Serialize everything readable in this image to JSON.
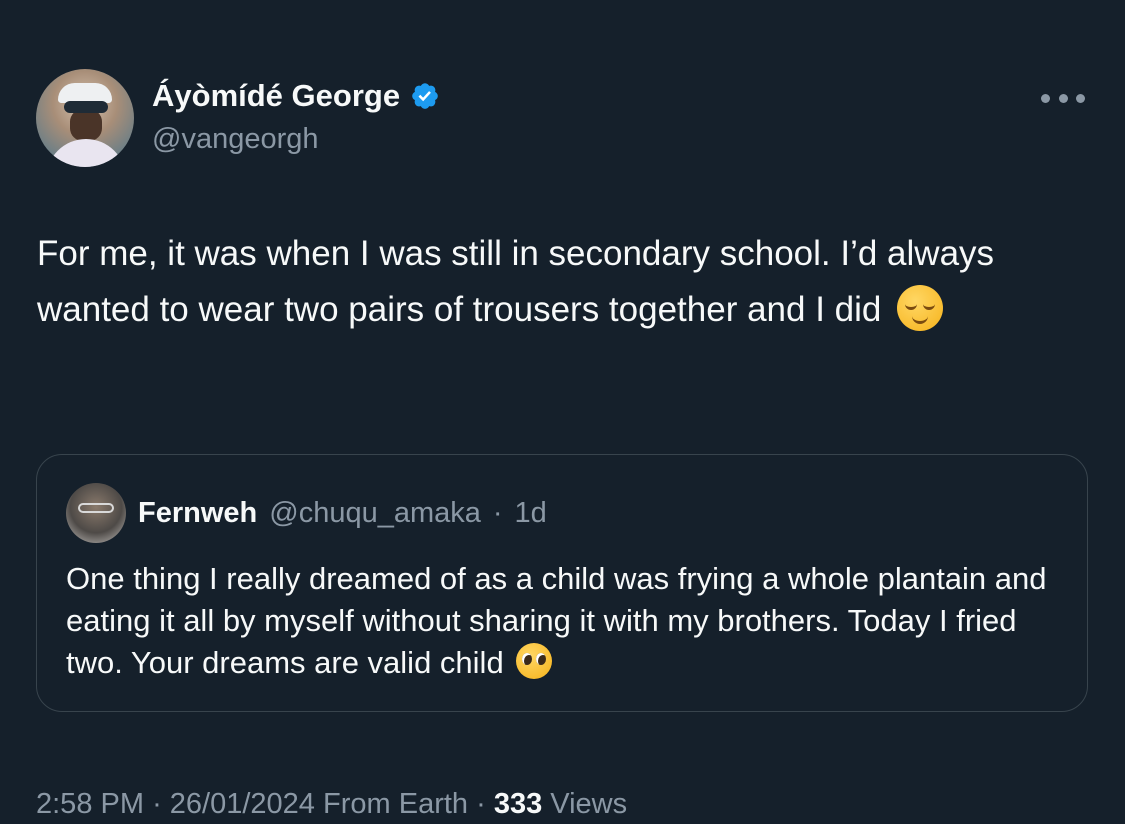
{
  "author": {
    "display_name": "Áyòmídé George",
    "handle": "@vangeorgh",
    "verified_icon": "verified-badge-icon",
    "verified_color": "#1d9bf0"
  },
  "tweet": {
    "text": "For me, it was when I was still in secondary school. I’d always wanted to wear two pairs of trousers together and I did",
    "emoji": "relieved-face-emoji"
  },
  "quoted": {
    "display_name": "Fernweh",
    "handle": "@chuqu_amaka",
    "separator": "·",
    "time": "1d",
    "text": "One thing I really dreamed of as a child was frying a whole plantain and eating it all by myself without sharing it with my brothers. Today I fried two. Your dreams are valid child",
    "emoji": "pleading-face-emoji"
  },
  "meta": {
    "time": "2:58 PM",
    "sep1": "·",
    "date": "26/01/2024",
    "source": "From Earth",
    "sep2": "·",
    "views_count": "333",
    "views_label": "Views"
  },
  "menu": {
    "icon": "more-options-icon"
  },
  "colors": {
    "background": "#15202b",
    "primary_text": "#f7f9f9",
    "secondary_text": "#8b98a5",
    "border": "#38444d"
  }
}
